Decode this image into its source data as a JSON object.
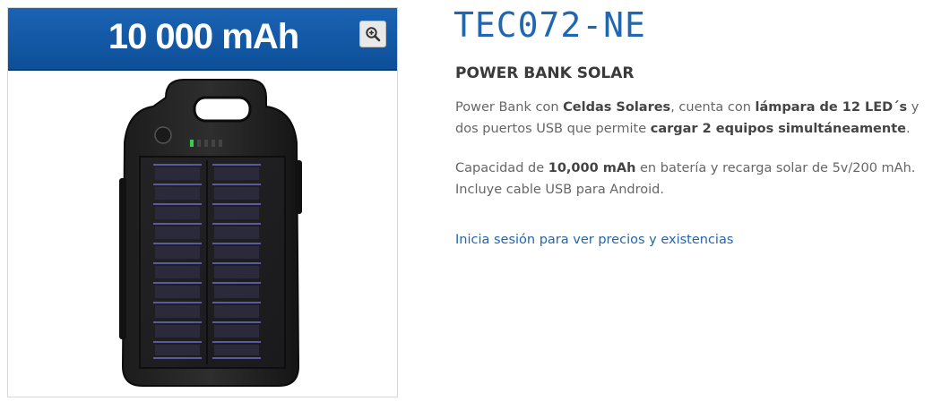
{
  "image": {
    "banner_text": "10 000 mAh",
    "banner_color": "#1563b3",
    "zoom_icon": "zoom-in-icon",
    "product_photo": "solar-power-bank-photo"
  },
  "product": {
    "sku": "TEC072-NE",
    "name": "POWER BANK SOLAR",
    "description_1": {
      "line1_a": "Power Bank con ",
      "line1_b": "Celdas Solares",
      "line1_c": ", cuenta con ",
      "line1_d": "lámpara de 12 LED´s",
      "line1_e": " y",
      "line2_a": "dos puertos USB que permite ",
      "line2_b": "cargar 2 equipos simultáneamente",
      "line2_c": "."
    },
    "description_2": {
      "line1_a": "Capacidad de ",
      "line1_b": "10,000 mAh",
      "line1_c": " en batería y recarga solar de 5v/200 mAh.",
      "line2": "Incluye cable USB para Android."
    },
    "login_link": "Inicia sesión para ver precios y existencias"
  },
  "colors": {
    "sku": "#2166b0",
    "link": "#2166b0",
    "text": "#666666"
  }
}
